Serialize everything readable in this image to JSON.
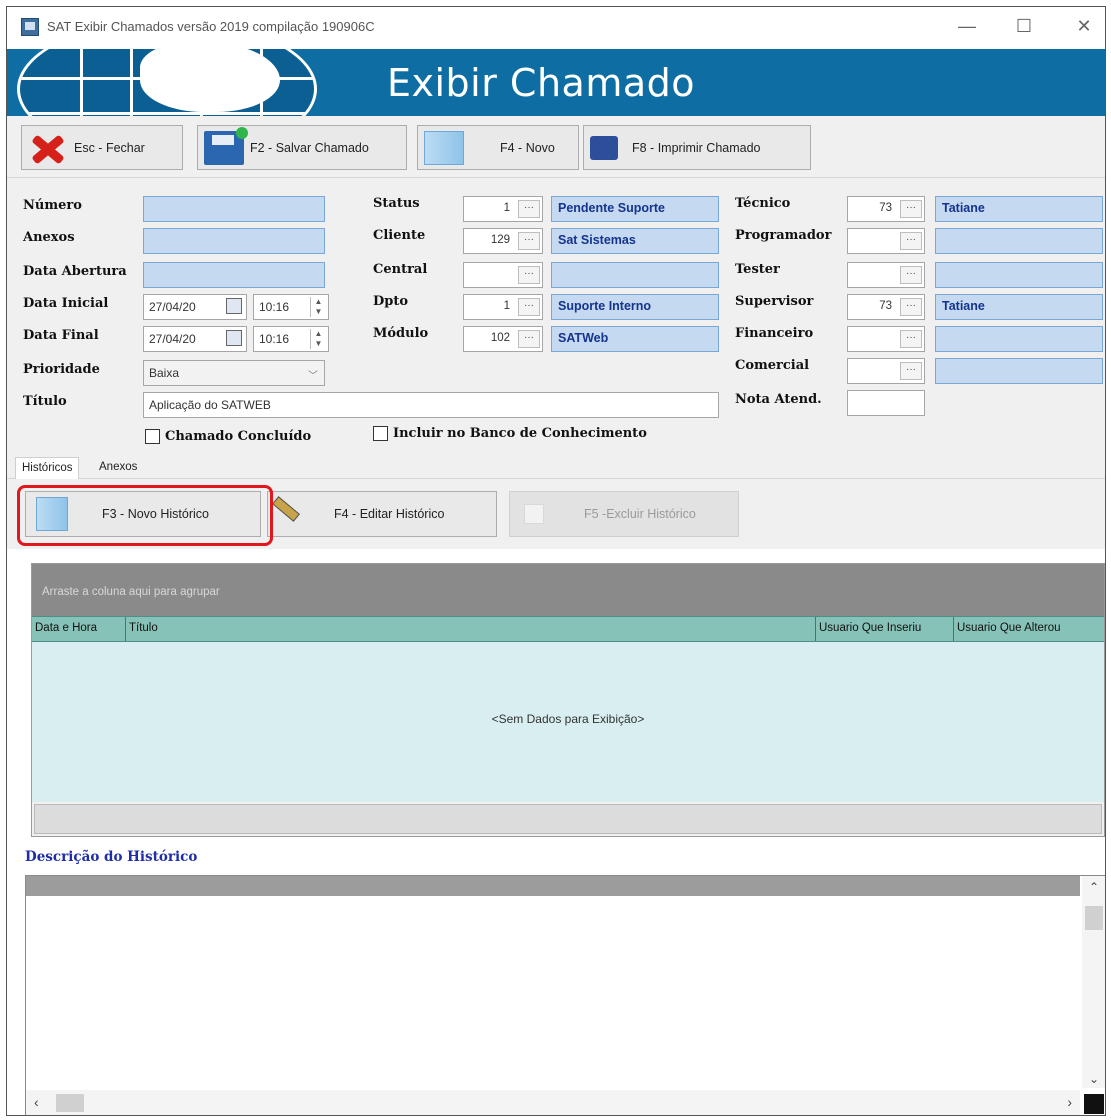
{
  "window": {
    "title": "SAT Exibir Chamados  versão 2019 compilação 190906C",
    "minimize": "—",
    "maximize": "☐",
    "close": "✕"
  },
  "banner": {
    "title": "Exibir Chamado"
  },
  "toolbar": {
    "close_label": "Esc - Fechar",
    "save_label": "F2 - Salvar Chamado",
    "new_label": "F4 - Novo",
    "print_label": "F8 - Imprimir Chamado"
  },
  "form": {
    "numero_label": "Número",
    "anexos_label": "Anexos",
    "data_abertura_label": "Data Abertura",
    "data_inicial_label": "Data Inicial",
    "data_final_label": "Data Final",
    "prioridade_label": "Prioridade",
    "titulo_label": "Título",
    "data_inicial_date": "27/04/20",
    "data_inicial_time": "10:16",
    "data_final_date": "27/04/20",
    "data_final_time": "10:16",
    "prioridade_value": "Baixa",
    "titulo_value": "Aplicação do SATWEB",
    "status_label": "Status",
    "cliente_label": "Cliente",
    "central_label": "Central",
    "dpto_label": "Dpto",
    "modulo_label": "Módulo",
    "status_code": "1",
    "status_value": "Pendente Suporte",
    "cliente_code": "129",
    "cliente_value": "Sat Sistemas",
    "central_code": "",
    "central_value": "",
    "dpto_code": "1",
    "dpto_value": "Suporte Interno",
    "modulo_code": "102",
    "modulo_value": "SATWeb",
    "tecnico_label": "Técnico",
    "programador_label": "Programador",
    "tester_label": "Tester",
    "supervisor_label": "Supervisor",
    "financeiro_label": "Financeiro",
    "comercial_label": "Comercial",
    "nota_label": "Nota Atend.",
    "tecnico_code": "73",
    "tecnico_value": "Tatiane",
    "supervisor_code": "73",
    "supervisor_value": "Tatiane",
    "dots": "···",
    "chk_concluido": "Chamado Concluído",
    "chk_banco": "Incluir no Banco de Conhecimento"
  },
  "tabs": [
    "Históricos",
    "Anexos"
  ],
  "history": {
    "new_label": "F3 - Novo Histórico",
    "edit_label": "F4 - Editar Histórico",
    "delete_label": "F5 -Excluir Histórico"
  },
  "grid": {
    "group_hint": "Arraste a coluna aqui para agrupar",
    "columns": [
      "Data e Hora",
      "Título",
      "Usuario Que Inseriu",
      "Usuario Que Alterou"
    ],
    "empty_text": "<Sem Dados para Exibição>"
  },
  "description": {
    "label": "Descrição do Histórico"
  },
  "colors": {
    "banner": "#0e6ea3",
    "field_fill": "#c5d9f1",
    "field_text": "#14348e",
    "grid_header": "#86c2b8",
    "grid_body": "#d9eef0",
    "highlight": "#e1171e"
  }
}
